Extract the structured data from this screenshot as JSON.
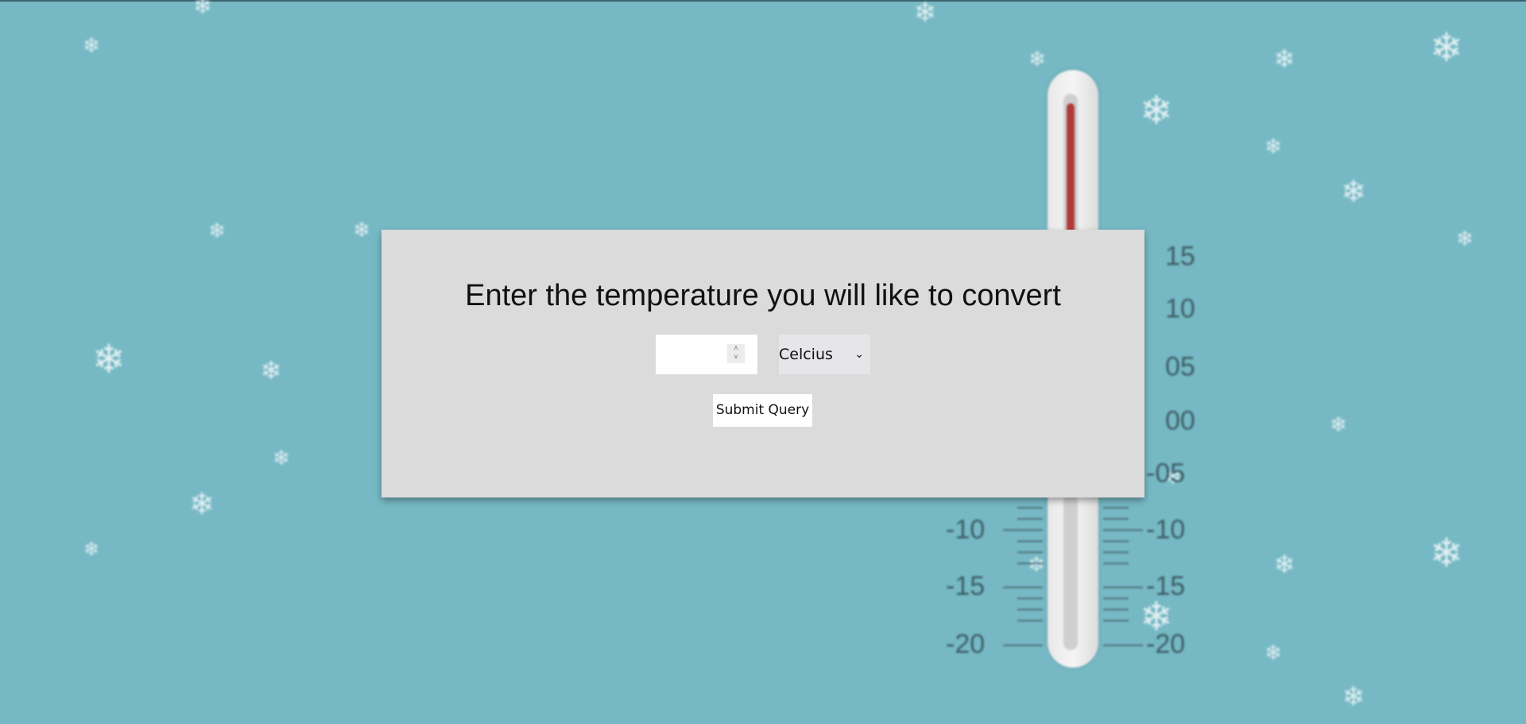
{
  "dialog": {
    "heading": "Enter the temperature you will like to convert",
    "temperature_input": {
      "value": "",
      "placeholder": ""
    },
    "unit_select": {
      "selected": "Celcius"
    },
    "submit_label": "Submit Query"
  },
  "thermometer": {
    "right_scale": [
      "15",
      "10",
      "05",
      "00",
      "-05",
      "-10",
      "-15",
      "-20"
    ],
    "left_scale": [
      "-10",
      "-15",
      "-20"
    ],
    "mercury_color": "#b03a3a"
  },
  "colors": {
    "background": "#76b9c5",
    "dialog_background": "#dbdbdb"
  }
}
